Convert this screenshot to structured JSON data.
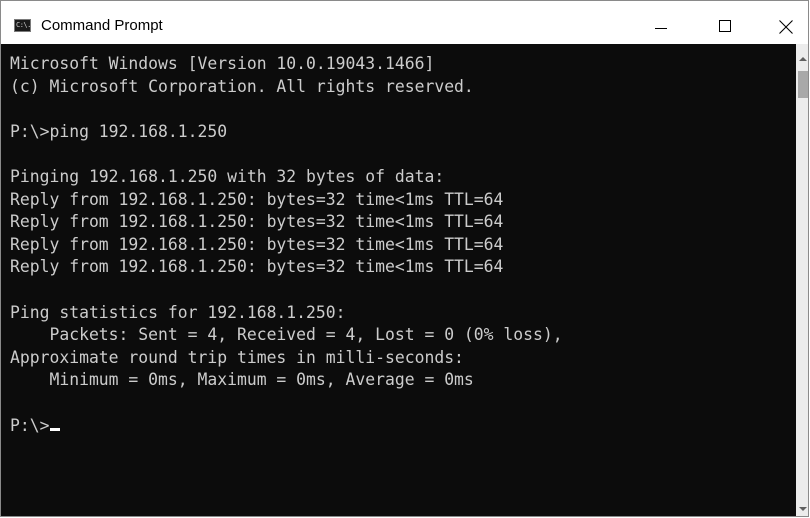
{
  "window": {
    "title": "Command Prompt",
    "icon": "command-prompt-icon",
    "icon_text": "C:\\."
  },
  "console": {
    "lines": [
      "Microsoft Windows [Version 10.0.19043.1466]",
      "(c) Microsoft Corporation. All rights reserved.",
      "",
      "P:\\>ping 192.168.1.250",
      "",
      "Pinging 192.168.1.250 with 32 bytes of data:",
      "Reply from 192.168.1.250: bytes=32 time<1ms TTL=64",
      "Reply from 192.168.1.250: bytes=32 time<1ms TTL=64",
      "Reply from 192.168.1.250: bytes=32 time<1ms TTL=64",
      "Reply from 192.168.1.250: bytes=32 time<1ms TTL=64",
      "",
      "Ping statistics for 192.168.1.250:",
      "    Packets: Sent = 4, Received = 4, Lost = 0 (0% loss),",
      "Approximate round trip times in milli-seconds:",
      "    Minimum = 0ms, Maximum = 0ms, Average = 0ms",
      "",
      "P:\\>"
    ]
  },
  "colors": {
    "background": "#0c0c0c",
    "text": "#cccccc"
  }
}
